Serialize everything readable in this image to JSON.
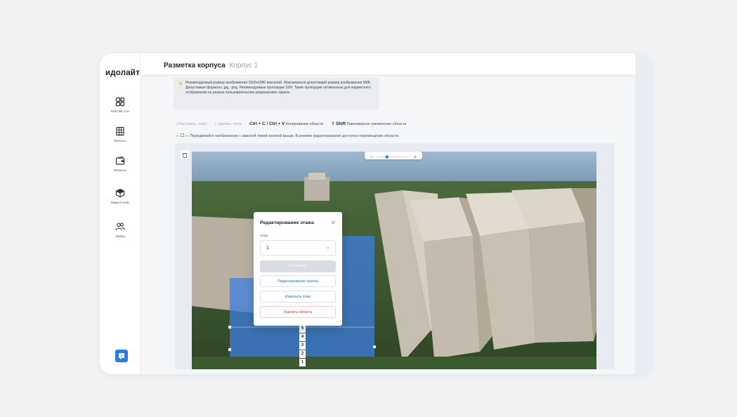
{
  "sidebar": {
    "logo": "идолайт",
    "items": [
      {
        "label": "Рабочий стол",
        "icon": "dashboard-icon"
      },
      {
        "label": "Проекты",
        "icon": "building-icon"
      },
      {
        "label": "Финансы",
        "icon": "wallet-icon"
      },
      {
        "label": "Маркетплейс",
        "icon": "box-icon"
      },
      {
        "label": "Заявки",
        "icon": "users-icon"
      }
    ],
    "chat_icon": "chat-icon"
  },
  "header": {
    "title": "Разметка корпуса",
    "subtitle": "Корпус 1"
  },
  "notice": {
    "text": "Рекомендуемый размер изображения 1920x1080 пикселей. Максимально допустимый размер изображения 5МБ. Допустимые форматы .jpg, .png. Рекомендуемые пропорции 16/9. Такие пропорции оптимальны для корректного отображения на разных пользовательских разрешениях экрана."
  },
  "toolbar": {
    "add_point": "Поставить точку",
    "remove_point": "Удалить точку",
    "copy_keys": "Ctrl + C / Ctrl + V",
    "copy_label": "Копирование области",
    "shift_key": "Shift",
    "shift_label": "Равномерное увеличение области",
    "drag_hint": "Передвигайте изображение с зажатой левой кнопкой мыши. В режиме редактирования доступно перемещение области."
  },
  "zoom": {
    "level": 0.3
  },
  "floors": [
    "5",
    "4",
    "3",
    "2",
    "1"
  ],
  "modal": {
    "title": "Редактирование этажа",
    "field_label": "Этаж",
    "selected_floor": "1",
    "save": "Сохранить",
    "edit_borders": "Редактирование границ",
    "change_plan": "Изменить план",
    "delete_area": "Удалить область"
  }
}
